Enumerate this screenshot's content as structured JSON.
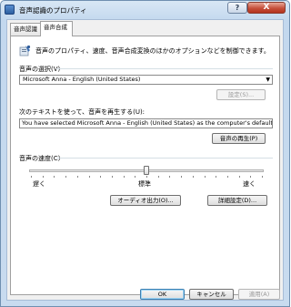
{
  "window": {
    "title": "音声認識のプロパティ",
    "help_label": "?",
    "close_label": "X"
  },
  "tabs": [
    {
      "label": "音声認識",
      "active": false
    },
    {
      "label": "音声合成",
      "active": true
    }
  ],
  "panel": {
    "description": "音声のプロパティ、速度、音声合成変換のほかのオプションなどを制御できます。",
    "voice_select_label": "音声の選択(V)",
    "voice_value": "Microsoft Anna - English (United States)",
    "settings_button": "設定(S)...",
    "preview_text_label": "次のテキストを使って、音声を再生する(U):",
    "preview_text_value": "You have selected Microsoft Anna - English (United States) as the computer's default voice.",
    "preview_button": "音声の再生(P)",
    "speed_label": "音声の速度(C)",
    "speed_slow": "遅く",
    "speed_normal": "標準",
    "speed_fast": "速く",
    "speed_level": 0.5,
    "audio_output_button": "オーディオ出力(O)...",
    "advanced_button": "詳細設定(D)..."
  },
  "footer": {
    "ok": "OK",
    "cancel": "キャンセル",
    "apply": "適用(A)"
  }
}
